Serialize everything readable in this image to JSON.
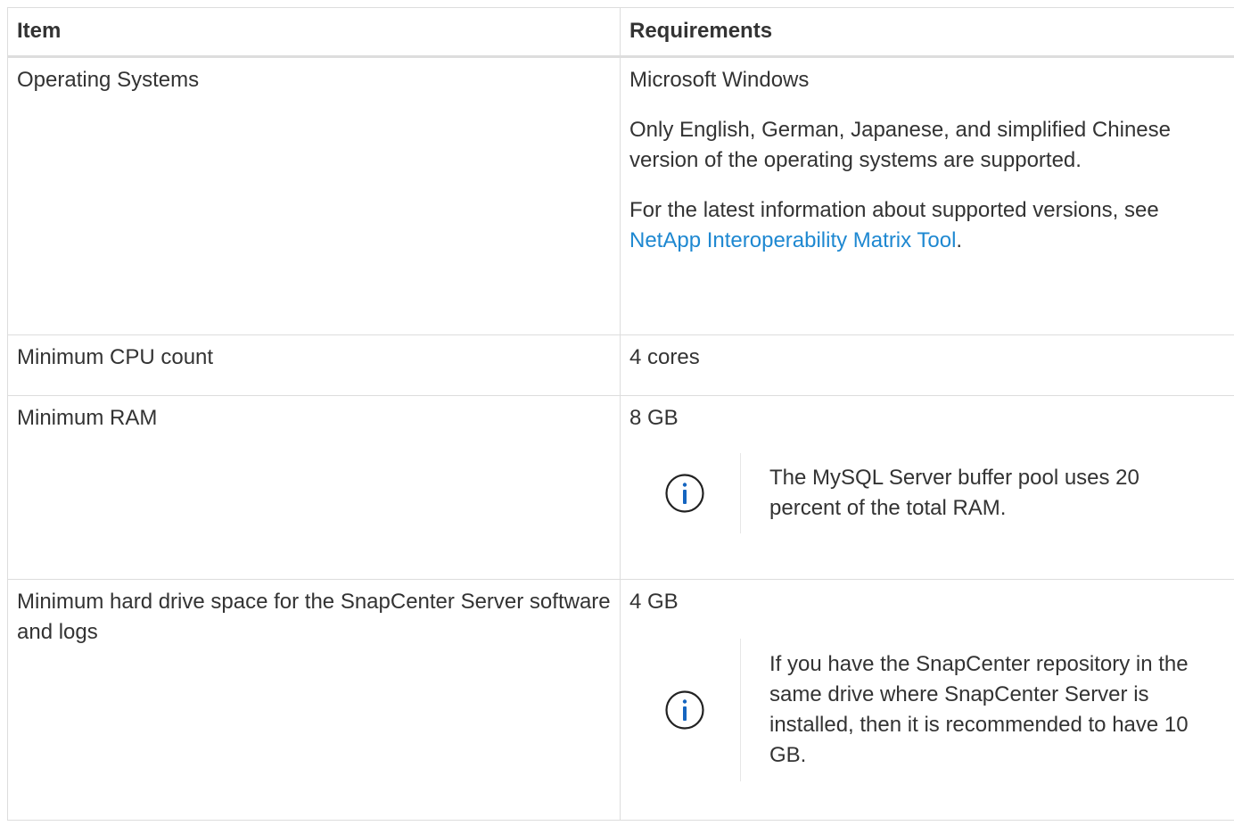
{
  "table": {
    "headers": {
      "item": "Item",
      "requirements": "Requirements"
    },
    "rows": {
      "os": {
        "item": "Operating Systems",
        "req_p1": "Microsoft Windows",
        "req_p2": "Only English, German, Japanese, and simplified Chinese version of the operating systems are supported.",
        "req_p3_prefix": "For the latest information about supported versions, see ",
        "req_p3_link": "NetApp Interoperability Matrix Tool",
        "req_p3_suffix": "."
      },
      "cpu": {
        "item": "Minimum CPU count",
        "req": "4 cores"
      },
      "ram": {
        "item": "Minimum RAM",
        "req": "8 GB",
        "note": "The MySQL Server buffer pool uses 20 percent of the total RAM.",
        "note_icon": "info-circle-icon"
      },
      "disk": {
        "item": "Minimum hard drive space for the SnapCenter Server software and logs",
        "req": "4 GB",
        "note": "If you have the SnapCenter repository in the same drive where SnapCenter Server is installed, then it is recommended to have 10 GB.",
        "note_icon": "info-circle-icon"
      }
    }
  },
  "colors": {
    "text": "#333333",
    "link": "#1e88d1",
    "icon": "#1565c0",
    "border": "#dddddd"
  }
}
